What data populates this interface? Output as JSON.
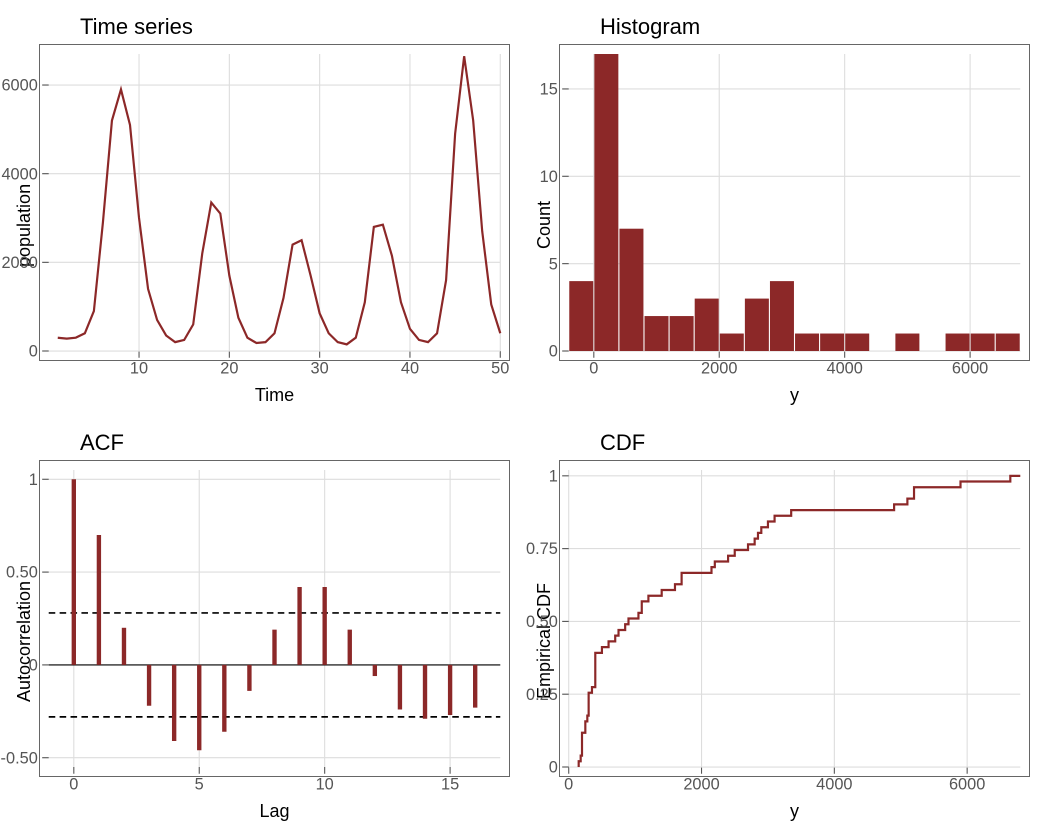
{
  "chart_data": [
    {
      "type": "line",
      "title": "Time series",
      "xlabel": "Time",
      "ylabel": "population",
      "xlim": [
        0,
        50
      ],
      "ylim": [
        0,
        6700
      ],
      "xticks": [
        10,
        20,
        30,
        40,
        50
      ],
      "yticks": [
        0,
        2000,
        4000,
        6000
      ],
      "x": [
        1,
        2,
        3,
        4,
        5,
        6,
        7,
        8,
        9,
        10,
        11,
        12,
        13,
        14,
        15,
        16,
        17,
        18,
        19,
        20,
        21,
        22,
        23,
        24,
        25,
        26,
        27,
        28,
        29,
        30,
        31,
        32,
        33,
        34,
        35,
        36,
        37,
        38,
        39,
        40,
        41,
        42,
        43,
        44,
        45,
        46,
        47,
        48,
        49,
        50
      ],
      "y": [
        300,
        280,
        300,
        400,
        900,
        2900,
        5200,
        5900,
        5100,
        3000,
        1400,
        700,
        350,
        200,
        250,
        600,
        2200,
        3350,
        3100,
        1700,
        750,
        300,
        180,
        200,
        400,
        1200,
        2400,
        2500,
        1700,
        850,
        400,
        200,
        150,
        300,
        1100,
        2800,
        2850,
        2150,
        1100,
        500,
        250,
        200,
        400,
        1600,
        4900,
        6650,
        5200,
        2700,
        1050,
        400
      ]
    },
    {
      "type": "bar",
      "title": "Histogram",
      "xlabel": "y",
      "ylabel": "Count",
      "xlim": [
        -400,
        6800
      ],
      "ylim": [
        0,
        17
      ],
      "xticks": [
        0,
        2000,
        4000,
        6000
      ],
      "yticks": [
        0,
        5,
        10,
        15
      ],
      "categories": [
        -200,
        200,
        600,
        1000,
        1400,
        1800,
        2200,
        2600,
        3000,
        3400,
        3800,
        4200,
        4600,
        5000,
        5400,
        5800,
        6200,
        6600
      ],
      "bin_width": 400,
      "values": [
        4,
        17,
        7,
        2,
        2,
        3,
        1,
        3,
        4,
        1,
        1,
        1,
        0,
        1,
        0,
        1,
        1,
        1
      ]
    },
    {
      "type": "bar",
      "title": "ACF",
      "xlabel": "Lag",
      "ylabel": "Autocorrelation",
      "xlim": [
        -1,
        17
      ],
      "ylim": [
        -0.55,
        1.05
      ],
      "xticks": [
        0,
        5,
        10,
        15
      ],
      "yticks": [
        -0.5,
        0.0,
        0.5,
        1.0
      ],
      "x": [
        0,
        1,
        2,
        3,
        4,
        5,
        6,
        7,
        8,
        9,
        10,
        11,
        12,
        13,
        14,
        15,
        16
      ],
      "values": [
        1.0,
        0.7,
        0.2,
        -0.22,
        -0.41,
        -0.46,
        -0.36,
        -0.14,
        0.19,
        0.42,
        0.42,
        0.19,
        -0.06,
        -0.24,
        -0.29,
        -0.27,
        -0.23
      ],
      "ci": 0.28
    },
    {
      "type": "line",
      "title": "CDF",
      "xlabel": "y",
      "ylabel": "Empirical CDF",
      "xlim": [
        0,
        6800
      ],
      "ylim": [
        0,
        1.02
      ],
      "xticks": [
        0,
        2000,
        4000,
        6000
      ],
      "yticks": [
        0.0,
        0.25,
        0.5,
        0.75,
        1.0
      ],
      "x": [
        150,
        180,
        200,
        200,
        200,
        200,
        250,
        250,
        280,
        300,
        300,
        300,
        300,
        350,
        400,
        400,
        400,
        400,
        400,
        400,
        500,
        600,
        700,
        750,
        850,
        900,
        1050,
        1100,
        1100,
        1200,
        1400,
        1600,
        1700,
        1700,
        2150,
        2200,
        2400,
        2500,
        2700,
        2800,
        2850,
        2900,
        3000,
        3100,
        3350,
        4900,
        5100,
        5200,
        5200,
        5900,
        6650
      ],
      "y_step": true
    }
  ]
}
